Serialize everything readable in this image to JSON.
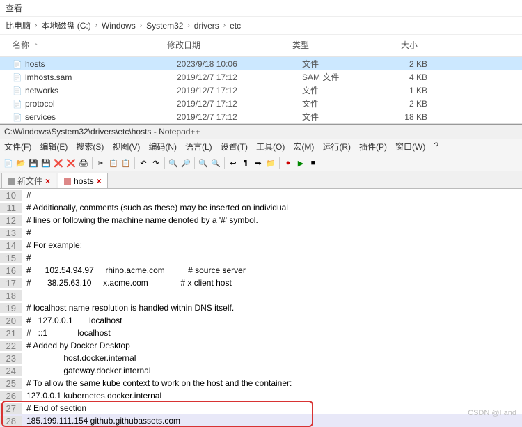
{
  "explorer": {
    "menu_view": "查看",
    "breadcrumb": [
      "比电脑",
      "本地磁盘 (C:)",
      "Windows",
      "System32",
      "drivers",
      "etc"
    ],
    "columns": {
      "name": "名称",
      "date": "修改日期",
      "type": "类型",
      "size": "大小"
    },
    "rows": [
      {
        "name": "hosts",
        "date": "2023/9/18 10:06",
        "type": "文件",
        "size": "2 KB",
        "selected": true
      },
      {
        "name": "lmhosts.sam",
        "date": "2019/12/7 17:12",
        "type": "SAM 文件",
        "size": "4 KB",
        "selected": false
      },
      {
        "name": "networks",
        "date": "2019/12/7 17:12",
        "type": "文件",
        "size": "1 KB",
        "selected": false
      },
      {
        "name": "protocol",
        "date": "2019/12/7 17:12",
        "type": "文件",
        "size": "2 KB",
        "selected": false
      },
      {
        "name": "services",
        "date": "2019/12/7 17:12",
        "type": "文件",
        "size": "18 KB",
        "selected": false
      }
    ]
  },
  "npp": {
    "title": "C:\\Windows\\System32\\drivers\\etc\\hosts - Notepad++",
    "menu": [
      "文件(F)",
      "编辑(E)",
      "搜索(S)",
      "视图(V)",
      "编码(N)",
      "语言(L)",
      "设置(T)",
      "工具(O)",
      "宏(M)",
      "运行(R)",
      "插件(P)",
      "窗口(W)",
      "?"
    ],
    "tabs": [
      {
        "label": "新文件",
        "active": false
      },
      {
        "label": "hosts",
        "active": true
      }
    ],
    "lines": [
      {
        "n": 10,
        "t": "#"
      },
      {
        "n": 11,
        "t": "# Additionally, comments (such as these) may be inserted on individual"
      },
      {
        "n": 12,
        "t": "# lines or following the machine name denoted by a '#' symbol."
      },
      {
        "n": 13,
        "t": "#"
      },
      {
        "n": 14,
        "t": "# For example:"
      },
      {
        "n": 15,
        "t": "#"
      },
      {
        "n": 16,
        "t": "#      102.54.94.97     rhino.acme.com          # source server"
      },
      {
        "n": 17,
        "t": "#       38.25.63.10     x.acme.com              # x client host"
      },
      {
        "n": 18,
        "t": ""
      },
      {
        "n": 19,
        "t": "# localhost name resolution is handled within DNS itself."
      },
      {
        "n": 20,
        "t": "#   127.0.0.1       localhost"
      },
      {
        "n": 21,
        "t": "#   ::1             localhost"
      },
      {
        "n": 22,
        "t": "# Added by Docker Desktop"
      },
      {
        "n": 23,
        "t": "                host.docker.internal"
      },
      {
        "n": 24,
        "t": "                gateway.docker.internal"
      },
      {
        "n": 25,
        "t": "# To allow the same kube context to work on the host and the container:"
      },
      {
        "n": 26,
        "t": "127.0.0.1 kubernetes.docker.internal"
      },
      {
        "n": 27,
        "t": "# End of section"
      },
      {
        "n": 28,
        "t": "185.199.111.154 github.githubassets.com"
      }
    ]
  },
  "watermark": "CSDN @I and",
  "icons": {
    "new": "📄",
    "open": "📂",
    "save": "💾",
    "saveall": "💾",
    "close": "❌",
    "closeall": "❌",
    "print": "🖨",
    "cut": "✂",
    "copy": "📋",
    "paste": "📋",
    "undo": "↶",
    "redo": "↷",
    "find": "🔍",
    "replace": "🔎",
    "zoomin": "🔍",
    "zoomout": "🔍",
    "wrap": "↩",
    "ws": "¶",
    "indent": "➡",
    "fold": "📁",
    "rec": "●",
    "play": "▶",
    "stop": "■"
  }
}
